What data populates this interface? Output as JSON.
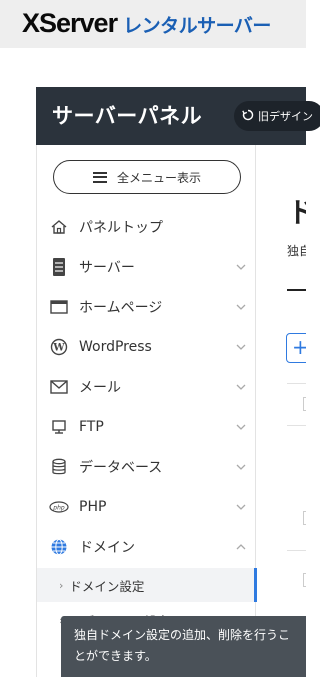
{
  "brand": {
    "logo_text": "XServer",
    "subtitle": "レンタルサーバー"
  },
  "panel": {
    "title": "サーバーパネル",
    "old_design_label": "旧デザイン"
  },
  "sidebar": {
    "all_menu_label": "全メニュー表示",
    "items": [
      {
        "label": "パネルトップ",
        "icon": "home-icon",
        "has_chevron": false
      },
      {
        "label": "サーバー",
        "icon": "server-icon",
        "has_chevron": true
      },
      {
        "label": "ホームページ",
        "icon": "browser-window-icon",
        "has_chevron": true
      },
      {
        "label": "WordPress",
        "icon": "wordpress-icon",
        "has_chevron": true
      },
      {
        "label": "メール",
        "icon": "mail-icon",
        "has_chevron": true
      },
      {
        "label": "FTP",
        "icon": "monitor-icon",
        "has_chevron": true
      },
      {
        "label": "データベース",
        "icon": "database-icon",
        "has_chevron": true
      },
      {
        "label": "PHP",
        "icon": "php-icon",
        "has_chevron": true
      },
      {
        "label": "ドメイン",
        "icon": "globe-icon",
        "has_chevron": true,
        "expanded": true
      }
    ],
    "sub_items": [
      {
        "label": "ドメイン設定",
        "active": true
      },
      {
        "label": "サブドメイン設定",
        "active": false
      }
    ]
  },
  "content": {
    "title": "ド",
    "subtitle": "独自"
  },
  "tooltip": {
    "text": "独自ドメイン設定の追加、削除を行うことができます。"
  },
  "colors": {
    "header_bg": "#2b333c",
    "brand_blue": "#1a5fb4",
    "active_accent": "#2f7ae0",
    "tooltip_bg": "#4a5158"
  }
}
